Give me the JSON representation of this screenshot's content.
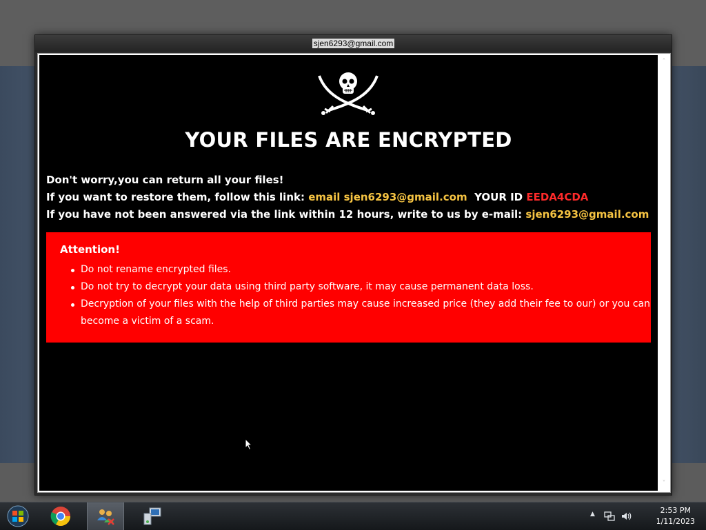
{
  "window": {
    "title": "sjen6293@gmail.com"
  },
  "note": {
    "headline": "YOUR FILES ARE ENCRYPTED",
    "line1": "Don't worry,you can return all your files!",
    "line2_prefix": "If you want to restore them, follow this link: ",
    "line2_link": "email sjen6293@gmail.com",
    "line2_id_label": "YOUR ID ",
    "line2_id_value": "EEDA4CDA",
    "line3_prefix": "If you have not been answered via the link within 12 hours, write to us by e-mail: ",
    "line3_email": "sjen6293@gmail.com",
    "attention_title": "Attention!",
    "attention_items": [
      "Do not rename encrypted files.",
      "Do not try to decrypt your data using third party software, it may cause permanent data loss.",
      "Decryption of your files with the help of third parties may cause increased price (they add their fee to our) or you can become a victim of a scam."
    ]
  },
  "colors": {
    "background": "#000000",
    "attention_box": "#ff0000",
    "highlight": "#f5c342",
    "id_color": "#ff2a2a"
  },
  "taskbar": {
    "apps": [
      "start-orb",
      "chrome-icon",
      "users-icon",
      "network-setup-icon"
    ],
    "clock_time": "2:53 PM",
    "clock_date": "1/11/2023"
  }
}
